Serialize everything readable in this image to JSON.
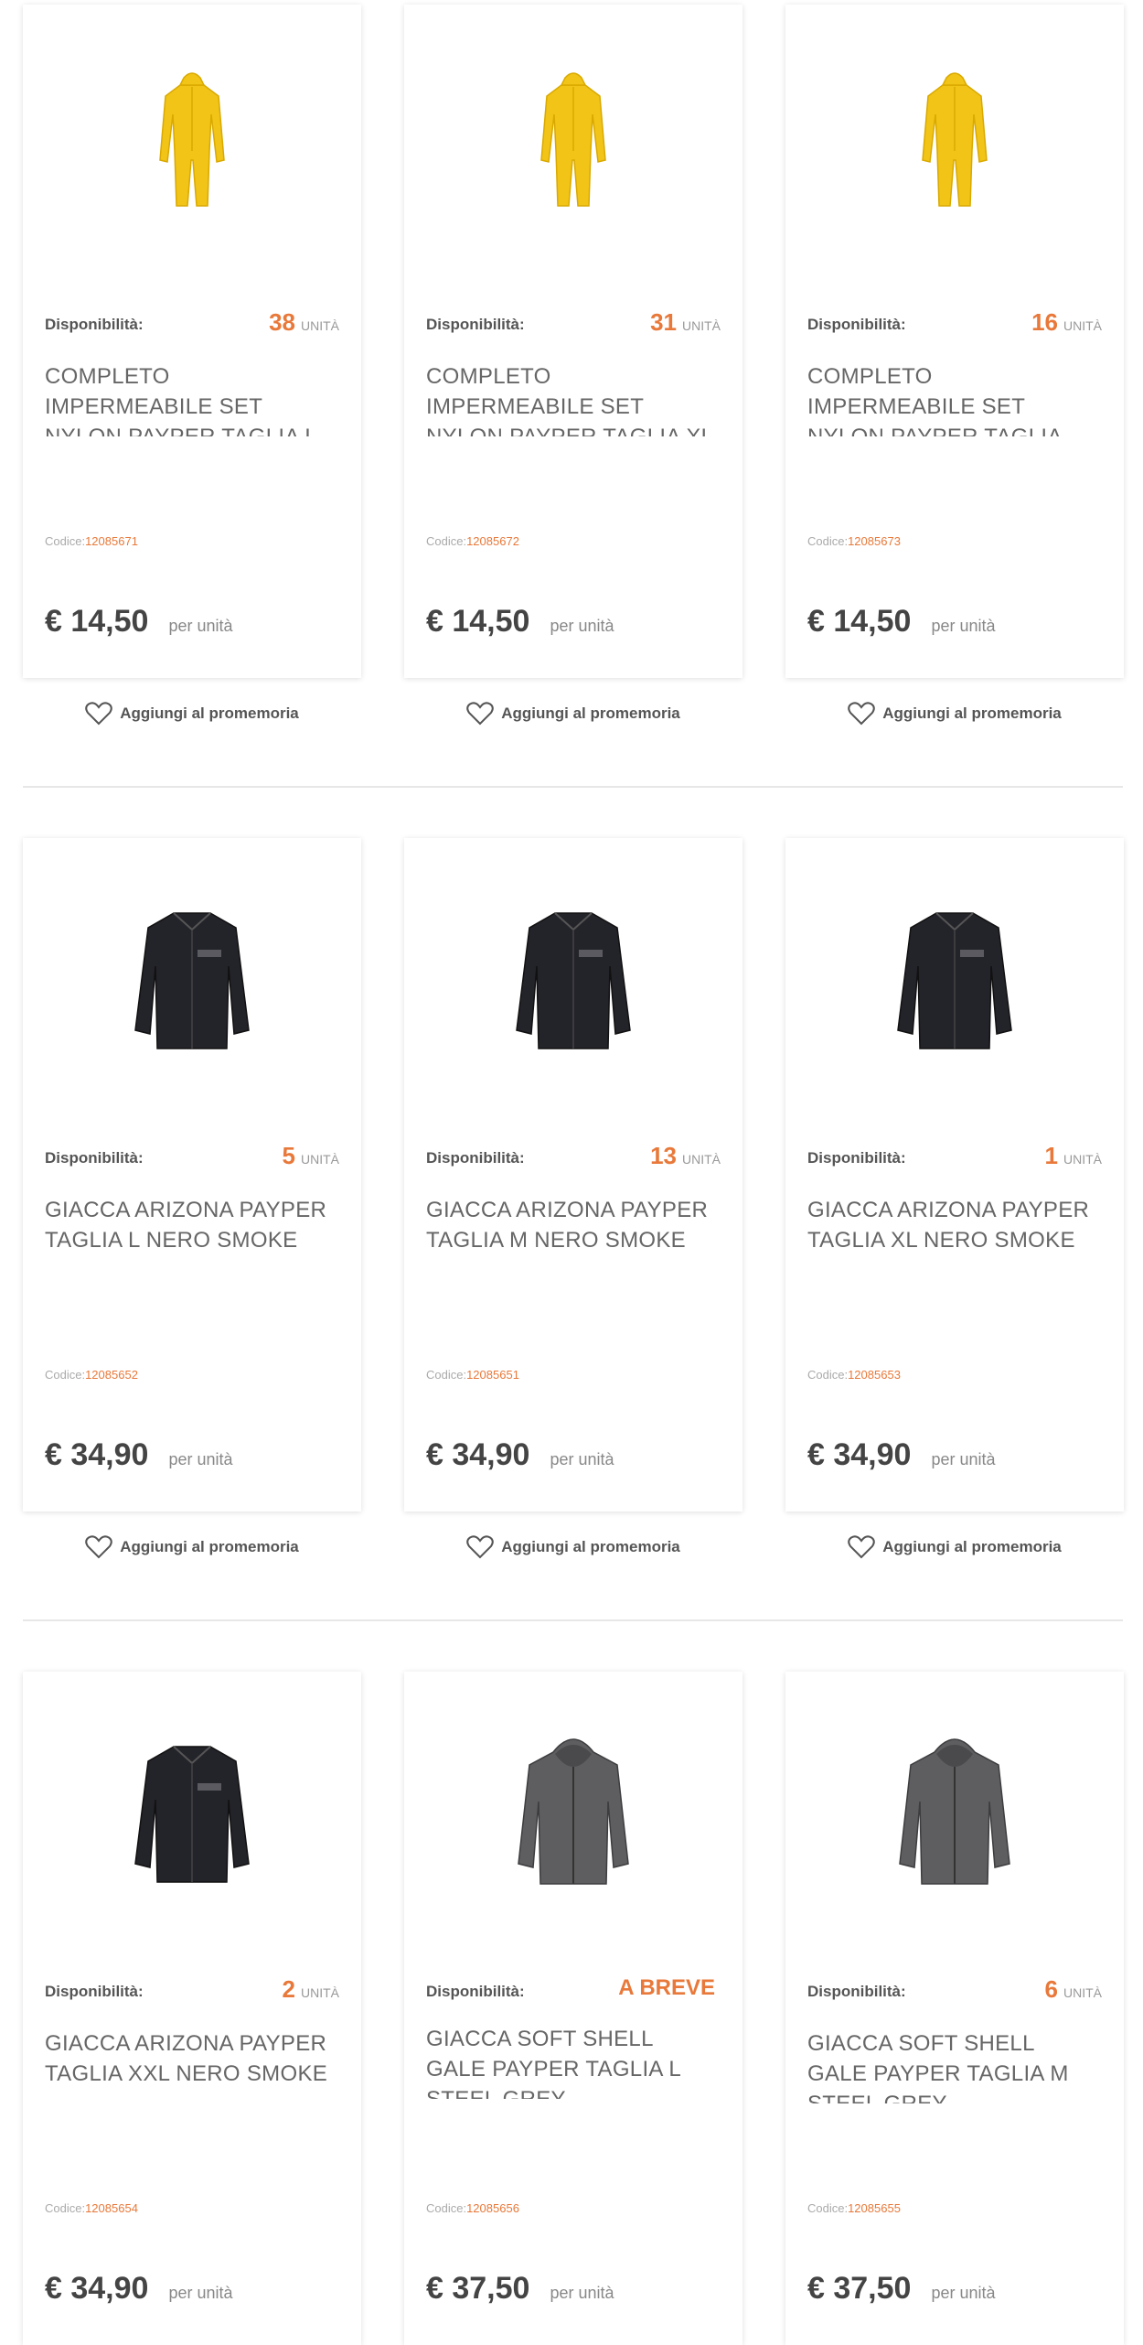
{
  "products": [
    {
      "availability_label": "Disponibilità:",
      "qty": "38",
      "unit": "UNITÀ",
      "title": "COMPLETO IMPERMEABILE SET NYLON PAYPER TAGLIA L GIALLO",
      "code_label": "Codice:",
      "code": "12085671",
      "price": "€ 14,50",
      "per": "per unità",
      "wishlist": "Aggiungi al promemoria",
      "image": "yellow-rain-suit"
    },
    {
      "availability_label": "Disponibilità:",
      "qty": "31",
      "unit": "UNITÀ",
      "title": "COMPLETO IMPERMEABILE SET NYLON PAYPER TAGLIA XL GIALLO",
      "code_label": "Codice:",
      "code": "12085672",
      "price": "€ 14,50",
      "per": "per unità",
      "wishlist": "Aggiungi al promemoria",
      "image": "yellow-rain-suit"
    },
    {
      "availability_label": "Disponibilità:",
      "qty": "16",
      "unit": "UNITÀ",
      "title": "COMPLETO IMPERMEABILE SET NYLON PAYPER TAGLIA XXL GIALLO",
      "code_label": "Codice:",
      "code": "12085673",
      "price": "€ 14,50",
      "per": "per unità",
      "wishlist": "Aggiungi al promemoria",
      "image": "yellow-rain-suit"
    },
    {
      "availability_label": "Disponibilità:",
      "qty": "5",
      "unit": "UNITÀ",
      "title": "GIACCA ARIZONA PAYPER TAGLIA L NERO SMOKE",
      "code_label": "Codice:",
      "code": "12085652",
      "price": "€ 34,90",
      "per": "per unità",
      "wishlist": "Aggiungi al promemoria",
      "image": "black-jacket"
    },
    {
      "availability_label": "Disponibilità:",
      "qty": "13",
      "unit": "UNITÀ",
      "title": "GIACCA ARIZONA PAYPER TAGLIA M NERO SMOKE",
      "code_label": "Codice:",
      "code": "12085651",
      "price": "€ 34,90",
      "per": "per unità",
      "wishlist": "Aggiungi al promemoria",
      "image": "black-jacket"
    },
    {
      "availability_label": "Disponibilità:",
      "qty": "1",
      "unit": "UNITÀ",
      "title": "GIACCA ARIZONA PAYPER TAGLIA XL NERO SMOKE",
      "code_label": "Codice:",
      "code": "12085653",
      "price": "€ 34,90",
      "per": "per unità",
      "wishlist": "Aggiungi al promemoria",
      "image": "black-jacket"
    },
    {
      "availability_label": "Disponibilità:",
      "qty": "2",
      "unit": "UNITÀ",
      "title": "GIACCA ARIZONA PAYPER TAGLIA XXL NERO SMOKE",
      "code_label": "Codice:",
      "code": "12085654",
      "price": "€ 34,90",
      "per": "per unità",
      "wishlist": "Aggiungi al promemoria",
      "image": "black-jacket"
    },
    {
      "availability_label": "Disponibilità:",
      "qty": "A BREVE",
      "unit": "",
      "title": "GIACCA SOFT SHELL GALE PAYPER TAGLIA L STEEL GREY",
      "code_label": "Codice:",
      "code": "12085656",
      "price": "€ 37,50",
      "per": "per unità",
      "wishlist": "Aggiungi al promemoria",
      "image": "grey-softshell"
    },
    {
      "availability_label": "Disponibilità:",
      "qty": "6",
      "unit": "UNITÀ",
      "title": "GIACCA SOFT SHELL GALE PAYPER TAGLIA M STEEL GREY",
      "code_label": "Codice:",
      "code": "12085655",
      "price": "€ 37,50",
      "per": "per unità",
      "wishlist": "Aggiungi al promemoria",
      "image": "grey-softshell"
    }
  ],
  "colors": {
    "accent": "#e8793a",
    "text": "#555555",
    "card_bg": "#ffffff",
    "divider": "#e7e7e7"
  }
}
